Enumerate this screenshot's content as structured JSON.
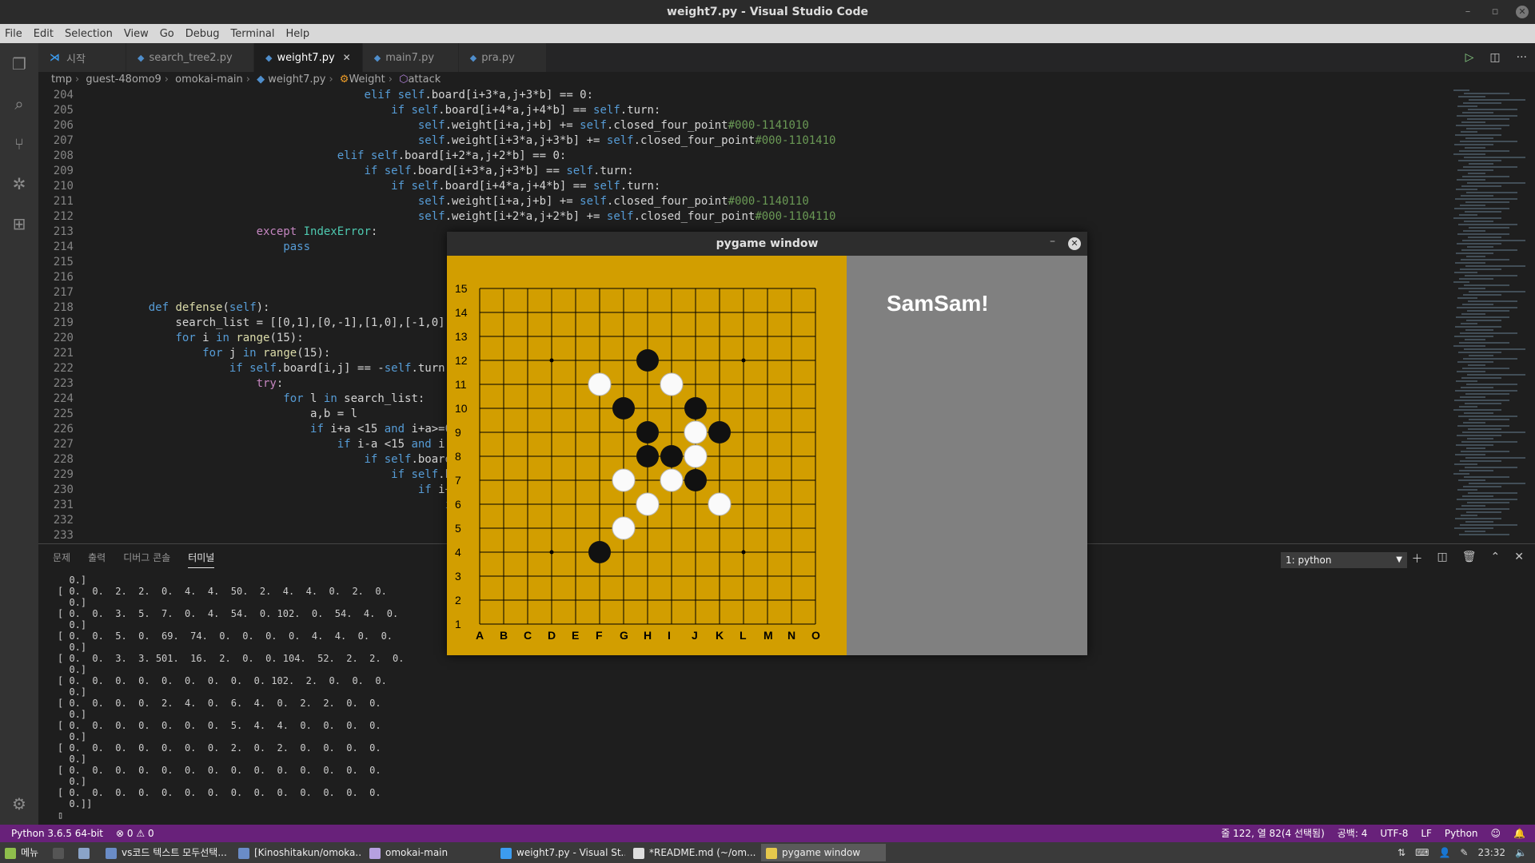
{
  "window": {
    "title": "weight7.py - Visual Studio Code"
  },
  "menu": [
    "File",
    "Edit",
    "Selection",
    "View",
    "Go",
    "Debug",
    "Terminal",
    "Help"
  ],
  "tabs": [
    {
      "label": "시작"
    },
    {
      "label": "search_tree2.py"
    },
    {
      "label": "weight7.py",
      "active": true
    },
    {
      "label": "main7.py"
    },
    {
      "label": "pra.py"
    }
  ],
  "breadcrumb": [
    "tmp",
    "guest-48omo9",
    "omokai-main",
    "weight7.py",
    "Weight",
    "attack"
  ],
  "code_lines": [
    {
      "n": "204",
      "html": "                                    <span class=\"kw\">elif</span> <span class=\"self\">self</span>.board[i+3*a,j+3*b] == 0:"
    },
    {
      "n": "205",
      "html": "                                        <span class=\"kw\">if</span> <span class=\"self\">self</span>.board[i+4*a,j+4*b] == <span class=\"self\">self</span>.turn:"
    },
    {
      "n": "206",
      "html": "                                            <span class=\"self\">self</span>.weight[i+a,j+b] += <span class=\"self\">self</span>.closed_four_point<span class=\"cm\">#000-1141010</span>"
    },
    {
      "n": "207",
      "html": "                                            <span class=\"self\">self</span>.weight[i+3*a,j+3*b] += <span class=\"self\">self</span>.closed_four_point<span class=\"cm\">#000-1101410</span>"
    },
    {
      "n": "208",
      "html": "                                <span class=\"kw\">elif</span> <span class=\"self\">self</span>.board[i+2*a,j+2*b] == 0:"
    },
    {
      "n": "209",
      "html": "                                    <span class=\"kw\">if</span> <span class=\"self\">self</span>.board[i+3*a,j+3*b] == <span class=\"self\">self</span>.turn:"
    },
    {
      "n": "210",
      "html": "                                        <span class=\"kw\">if</span> <span class=\"self\">self</span>.board[i+4*a,j+4*b] == <span class=\"self\">self</span>.turn:"
    },
    {
      "n": "211",
      "html": "                                            <span class=\"self\">self</span>.weight[i+a,j+b] += <span class=\"self\">self</span>.closed_four_point<span class=\"cm\">#000-1140110</span>"
    },
    {
      "n": "212",
      "html": "                                            <span class=\"self\">self</span>.weight[i+2*a,j+2*b] += <span class=\"self\">self</span>.closed_four_point<span class=\"cm\">#000-1104110</span>"
    },
    {
      "n": "213",
      "html": "                    <span class=\"bi\">except</span> <span class=\"cls\">IndexError</span>:"
    },
    {
      "n": "214",
      "html": "                        <span class=\"kw\">pass</span>"
    },
    {
      "n": "215",
      "html": ""
    },
    {
      "n": "216",
      "html": ""
    },
    {
      "n": "217",
      "html": ""
    },
    {
      "n": "218",
      "html": "    <span class=\"kw\">def</span> <span class=\"fn\">defense</span>(<span class=\"self\">self</span>):"
    },
    {
      "n": "219",
      "html": "        search_list = [[0,1],[0,-1],[1,0],[-1,0],[1,1"
    },
    {
      "n": "220",
      "html": "        <span class=\"kw\">for</span> i <span class=\"kw\">in</span> <span class=\"fn\">range</span>(15):"
    },
    {
      "n": "221",
      "html": "            <span class=\"kw\">for</span> j <span class=\"kw\">in</span> <span class=\"fn\">range</span>(15):"
    },
    {
      "n": "222",
      "html": "                <span class=\"kw\">if</span> <span class=\"self\">self</span>.board[i,j] == -<span class=\"self\">self</span>.turn:"
    },
    {
      "n": "223",
      "html": "                    <span class=\"bi\">try</span>:"
    },
    {
      "n": "224",
      "html": "                        <span class=\"kw\">for</span> l <span class=\"kw\">in</span> search_list:"
    },
    {
      "n": "225",
      "html": "                            a,b = l"
    },
    {
      "n": "226",
      "html": "                            <span class=\"kw\">if</span> i+a &lt;15 <span class=\"kw\">and</span> i+a&gt;=0 <span class=\"kw\">and</span>"
    },
    {
      "n": "227",
      "html": "                                <span class=\"kw\">if</span> i-a &lt;15 <span class=\"kw\">and</span> i-a&gt;=0"
    },
    {
      "n": "228",
      "html": "                                    <span class=\"kw\">if</span> <span class=\"self\">self</span>.board[i-a"
    },
    {
      "n": "229",
      "html": "                                        <span class=\"kw\">if</span> <span class=\"self\">self</span>.board"
    },
    {
      "n": "230",
      "html": "                                            <span class=\"kw\">if</span> i+3*a"
    },
    {
      "n": "231",
      "html": "                                                <span class=\"kw\">if</span> <span class=\"self\">se</span>"
    },
    {
      "n": "232",
      "html": ""
    },
    {
      "n": "233",
      "html": ""
    }
  ],
  "panel": {
    "tabs": [
      "문제",
      "출력",
      "디버그 콘솔",
      "터미널"
    ],
    "terminal_select": "1: python",
    "terminal_lines": [
      "  0.]",
      "[ 0.  0.  2.  2.  0.  4.  4.  50.  2.  4.  4.  0.  2.  0.",
      "  0.]",
      "[ 0.  0.  3.  5.  7.  0.  4.  54.  0. 102.  0.  54.  4.  0.",
      "  0.]",
      "[ 0.  0.  5.  0.  69.  74.  0.  0.  0.  0.  4.  4.  0.  0.",
      "  0.]",
      "[ 0.  0.  3.  3. 501.  16.  2.  0.  0. 104.  52.  2.  2.  0.",
      "  0.]",
      "[ 0.  0.  0.  0.  0.  0.  0.  0.  0. 102.  2.  0.  0.  0.",
      "  0.]",
      "[ 0.  0.  0.  0.  2.  4.  0.  6.  4.  0.  2.  2.  0.  0.",
      "  0.]",
      "[ 0.  0.  0.  0.  0.  0.  0.  5.  4.  4.  0.  0.  0.  0.",
      "  0.]",
      "[ 0.  0.  0.  0.  0.  0.  0.  2.  0.  2.  0.  0.  0.  0.",
      "  0.]",
      "[ 0.  0.  0.  0.  0.  0.  0.  0.  0.  0.  0.  0.  0.  0.",
      "  0.]",
      "[ 0.  0.  0.  0.  0.  0.  0.  0.  0.  0.  0.  0.  0.  0.",
      "  0.]]",
      "▯"
    ]
  },
  "pygame": {
    "title": "pygame window",
    "message": "SamSam!",
    "columns": [
      "A",
      "B",
      "C",
      "D",
      "E",
      "F",
      "G",
      "H",
      "I",
      "J",
      "K",
      "L",
      "M",
      "N",
      "O"
    ],
    "rows": [
      "1",
      "2",
      "3",
      "4",
      "5",
      "6",
      "7",
      "8",
      "9",
      "10",
      "11",
      "12",
      "13",
      "14",
      "15"
    ],
    "black_stones": [
      [
        "H",
        12
      ],
      [
        "G",
        10
      ],
      [
        "J",
        10
      ],
      [
        "H",
        9
      ],
      [
        "K",
        9
      ],
      [
        "H",
        8
      ],
      [
        "I",
        8
      ],
      [
        "J",
        7
      ],
      [
        "F",
        4
      ]
    ],
    "white_stones": [
      [
        "F",
        11
      ],
      [
        "I",
        11
      ],
      [
        "J",
        9
      ],
      [
        "J",
        8
      ],
      [
        "G",
        7
      ],
      [
        "I",
        7
      ],
      [
        "H",
        6
      ],
      [
        "K",
        6
      ],
      [
        "G",
        5
      ]
    ],
    "board_color": "#d29e00"
  },
  "statusbar": {
    "python": "Python 3.6.5 64-bit",
    "errors": "0",
    "warnings": "0",
    "position": "줄 122, 열 82(4 선택됨)",
    "spaces": "공백: 4",
    "encoding": "UTF-8",
    "eol": "LF",
    "language": "Python"
  },
  "taskbar": {
    "menu": "메뉴",
    "items": [
      {
        "label": "vs코드 텍스트 모두선택..."
      },
      {
        "label": "[Kinoshitakun/omoka..."
      },
      {
        "label": "omokai-main"
      },
      {
        "label": "weight7.py - Visual St..."
      },
      {
        "label": "*README.md (~/om..."
      },
      {
        "label": "pygame window",
        "active": true
      }
    ],
    "clock": "23:32"
  },
  "colors": {
    "statusbar": "#68217a",
    "board": "#d29e00",
    "panel_right": "#808080"
  }
}
